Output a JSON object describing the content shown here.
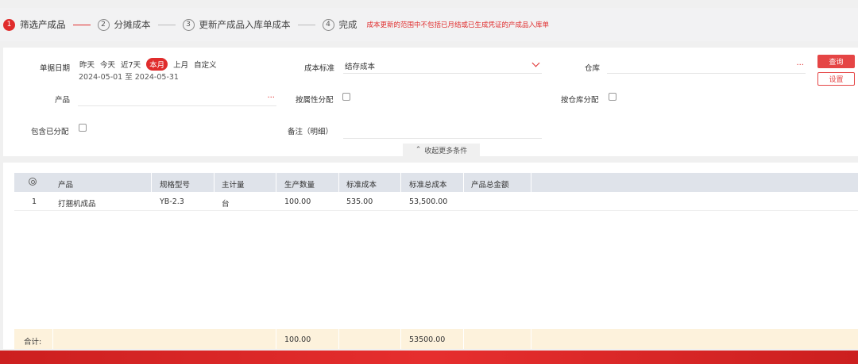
{
  "steps": [
    {
      "num": "1",
      "label": "筛选产成品",
      "active": true
    },
    {
      "num": "2",
      "label": "分摊成本",
      "active": false
    },
    {
      "num": "3",
      "label": "更新产成品入库单成本",
      "active": false
    },
    {
      "num": "4",
      "label": "完成",
      "active": false
    }
  ],
  "steps_note": "成本更新的范围中不包括已月结或已生成凭证的产成品入库单",
  "filter": {
    "date_label": "单据日期",
    "quick_dates": [
      "昨天",
      "今天",
      "近7天",
      "本月",
      "上月",
      "自定义"
    ],
    "date_range": "2024-05-01 至 2024-05-31",
    "cost_std_label": "成本标准",
    "cost_std_value": "结存成本",
    "warehouse_label": "仓库",
    "product_label": "产品",
    "by_attr_label": "按属性分配",
    "by_warehouse_label": "按仓库分配",
    "include_allocated_label": "包含已分配",
    "remark_label": "备注（明细）",
    "query_button": "查询",
    "setting_button": "设置",
    "collapse_label": "收起更多条件",
    "more_icon": "···"
  },
  "table": {
    "headers": [
      "产品",
      "规格型号",
      "主计量",
      "生产数量",
      "标准成本",
      "标准总成本",
      "产品总金额"
    ],
    "rows": [
      {
        "index": "1",
        "product": "打捆机成品",
        "spec": "YB-2.3",
        "unit": "台",
        "qty": "100.00",
        "std_cost": "535.00",
        "std_total": "53,500.00",
        "total_amount": ""
      }
    ],
    "footer": {
      "label": "合计:",
      "qty": "100.00",
      "std_total": "53500.00"
    }
  }
}
